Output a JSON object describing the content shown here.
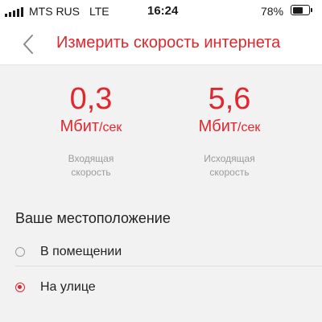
{
  "status_bar": {
    "carrier": "MTS RUS",
    "network": "LTE",
    "time": "16:24",
    "battery_percent": "78%",
    "battery_level": 0.78
  },
  "header": {
    "back_icon": "chevron-left-icon",
    "title": "Измерить скорость интернета"
  },
  "speeds": {
    "download": {
      "value": "0,3",
      "unit_main": "Мбит",
      "unit_sub": "/сек",
      "caption_line1": "Входящая",
      "caption_line2": "скорость"
    },
    "upload": {
      "value": "5,6",
      "unit_main": "Мбит",
      "unit_sub": "/сек",
      "caption_line1": "Исходящая",
      "caption_line2": "скорость"
    }
  },
  "location": {
    "title": "Ваше местоположение",
    "options": [
      {
        "label": "В помещении",
        "selected": false
      },
      {
        "label": "На улице",
        "selected": true
      }
    ]
  },
  "colors": {
    "accent": "#e1262d",
    "background": "#f2f2f3",
    "muted_text": "#9b9b9b"
  }
}
